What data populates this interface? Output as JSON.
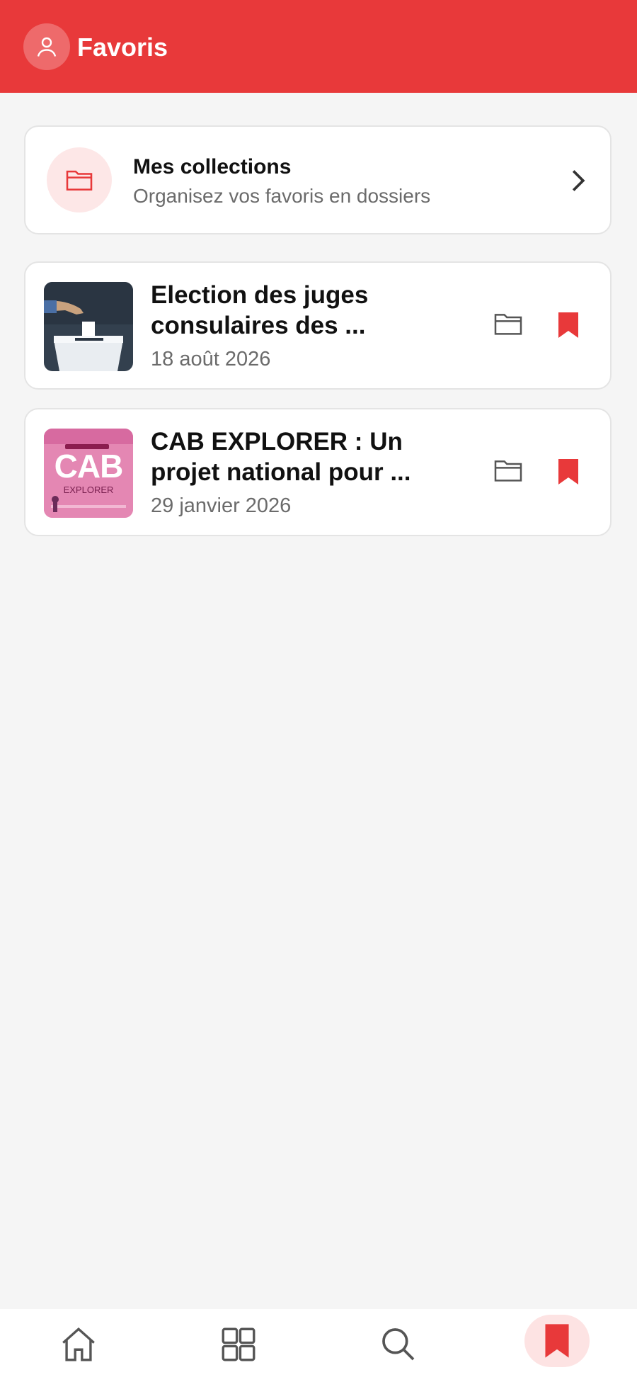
{
  "header": {
    "title": "Favoris",
    "avatar_icon": "user-icon",
    "bg_color": "#e8393a"
  },
  "collections": {
    "title": "Mes collections",
    "subtitle": "Organisez vos favoris en dossiers",
    "icon": "folder-icon"
  },
  "articles": [
    {
      "title": "Election des juges consulaires des ...",
      "date": "18 août 2026",
      "thumb": "ballot-box-image"
    },
    {
      "title": "CAB EXPLORER : Un projet national pour ...",
      "date": "29 janvier 2026",
      "thumb": "cab-explorer-poster",
      "thumb_text": "CAB",
      "thumb_sub": "EXPLORER"
    }
  ],
  "nav": {
    "items": [
      "home-icon",
      "grid-icon",
      "search-icon",
      "bookmark-icon"
    ],
    "active": "bookmark-icon",
    "accent": "#e8393a"
  }
}
